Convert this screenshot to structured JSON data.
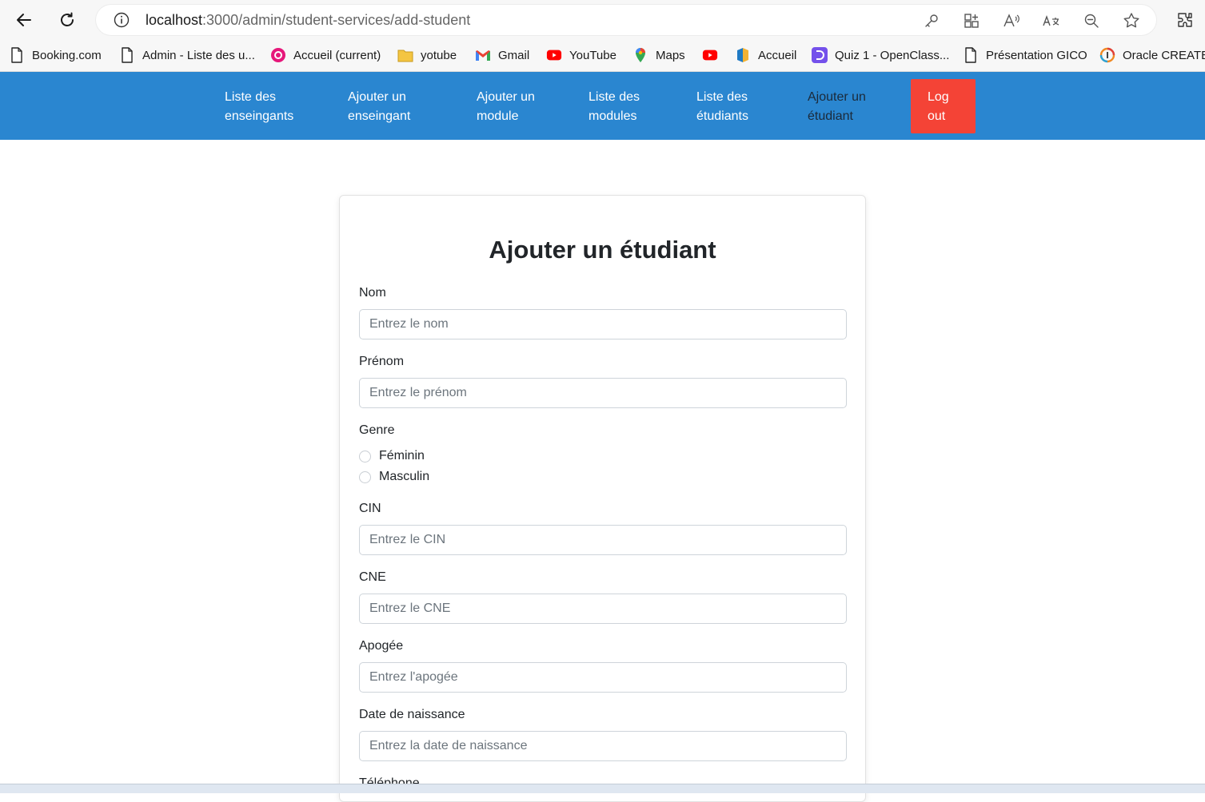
{
  "browser": {
    "url_host": "localhost",
    "url_path": ":3000/admin/student-services/add-student",
    "icons": [
      "back-arrow-icon",
      "reload-icon",
      "info-icon",
      "key-icon",
      "apps-icon",
      "read-aloud-icon",
      "translate-icon",
      "zoom-icon",
      "favorite-star-icon",
      "extensions-icon"
    ]
  },
  "bookmarks": [
    {
      "label": "Booking.com",
      "icon": "page-icon"
    },
    {
      "label": "Admin - Liste des u...",
      "icon": "page-icon"
    },
    {
      "label": "Accueil (current)",
      "icon": "wamp-icon"
    },
    {
      "label": "yotube",
      "icon": "folder-icon"
    },
    {
      "label": "Gmail",
      "icon": "gmail-icon"
    },
    {
      "label": "YouTube",
      "icon": "youtube-icon"
    },
    {
      "label": "Maps",
      "icon": "maps-pin-icon"
    },
    {
      "label": "",
      "icon": "youtube-icon"
    },
    {
      "label": "Accueil",
      "icon": "site-icon"
    },
    {
      "label": "Quiz 1 - OpenClass...",
      "icon": "openclassrooms-icon"
    },
    {
      "label": "Présentation GICO",
      "icon": "page-icon"
    },
    {
      "label": "Oracle CREATE",
      "icon": "oracle-icon"
    }
  ],
  "nav": {
    "items": [
      {
        "line1": "Liste des",
        "line2": "enseingants"
      },
      {
        "line1": "Ajouter un",
        "line2": "enseingant"
      },
      {
        "line1": "Ajouter un",
        "line2": "module"
      },
      {
        "line1": "Liste des",
        "line2": "modules"
      },
      {
        "line1": "Liste des",
        "line2": "étudiants"
      },
      {
        "line1": "Ajouter un",
        "line2": "étudiant"
      }
    ],
    "logout": {
      "line1": "Log",
      "line2": "out"
    },
    "colors": {
      "bar": "#2a86d0",
      "logout": "#f44336",
      "active_text": "#1b2a3a"
    }
  },
  "form": {
    "title": "Ajouter un étudiant",
    "nom": {
      "label": "Nom",
      "placeholder": "Entrez le nom"
    },
    "prenom": {
      "label": "Prénom",
      "placeholder": "Entrez le prénom"
    },
    "genre": {
      "label": "Genre",
      "options": [
        "Féminin",
        "Masculin"
      ]
    },
    "cin": {
      "label": "CIN",
      "placeholder": "Entrez le CIN"
    },
    "cne": {
      "label": "CNE",
      "placeholder": "Entrez le CNE"
    },
    "apogee": {
      "label": "Apogée",
      "placeholder": "Entrez l'apogée"
    },
    "naissance": {
      "label": "Date de naissance",
      "placeholder": "Entrez la date de naissance"
    },
    "telephone": {
      "label": "Téléphone"
    }
  }
}
